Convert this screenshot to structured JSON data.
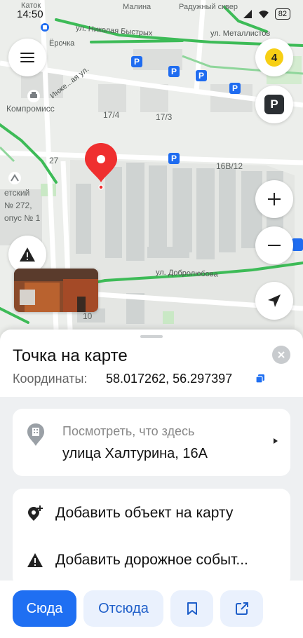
{
  "status": {
    "time": "14:50",
    "battery": "82"
  },
  "map": {
    "labels": {
      "katok": "Каток",
      "malina": "Малина",
      "raduzhny": "Радужный сквер",
      "nikolaya": "ул. Николая Быстрых",
      "metallistov": "ул. Металлистов",
      "ostanovka": "Ёрочка",
      "inzhen": "Инже...ая ул.",
      "kompromiss": "Компромисс",
      "n17_4": "17/4",
      "n17_3": "17/3",
      "n27": "27",
      "n16v12": "16В/12",
      "detsky1": "етский",
      "detsky2": "№ 272,",
      "detsky3": "опус № 1",
      "dobrolyubova": "ул. Добролюбова",
      "n10": "10"
    },
    "badge_number": "4",
    "parking_letter": "P",
    "pin_color": "#ef2f2f"
  },
  "sheet": {
    "title": "Точка на карте",
    "coords_label": "Координаты:",
    "coords_value": "58.017262, 56.297397",
    "whats_here_title": "Посмотреть, что здесь",
    "whats_here_address": "улица Халтурина, 16А",
    "menu": [
      {
        "label": "Добавить объект на карту",
        "icon": "add-place-icon"
      },
      {
        "label": "Добавить дорожное событ...",
        "icon": "warning-icon"
      }
    ]
  },
  "actions": {
    "here": "Сюда",
    "from": "Отсюда",
    "save_icon": "bookmark-icon",
    "share_icon": "share-icon"
  },
  "colors": {
    "accent": "#1f6ff2",
    "accent_light": "#eaf1fd",
    "road_green": "#3dbb57",
    "parking_blue": "#1f6cf0",
    "badge_yellow": "#f7cf15"
  }
}
